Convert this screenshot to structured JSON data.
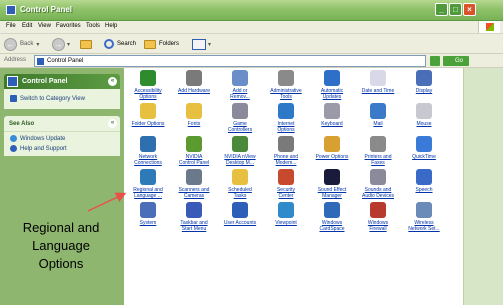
{
  "window": {
    "title": "Control Panel",
    "buttons": {
      "minimize": "_",
      "maximize": "□",
      "close": "×"
    }
  },
  "menu": [
    "File",
    "Edit",
    "View",
    "Favorites",
    "Tools",
    "Help"
  ],
  "toolbar": {
    "back_label": "Back",
    "search_label": "Search",
    "folders_label": "Folders"
  },
  "address": {
    "label": "Address",
    "value": "Control Panel",
    "go_label": "Go"
  },
  "task_pane": {
    "control_panel": {
      "title": "Control Panel",
      "collapse": "«",
      "link": "Switch to Category View"
    },
    "see_also": {
      "title": "See Also",
      "collapse": "«",
      "links": [
        "Windows Update",
        "Help and Support"
      ]
    }
  },
  "items": [
    {
      "label": "Accessibility\nOptions",
      "icon": "accessibility-icon",
      "color": "#2e8b2e"
    },
    {
      "label": "Add Hardware",
      "icon": "printer-hardware-icon",
      "color": "#7a7a7a"
    },
    {
      "label": "Add or\nRemov...",
      "icon": "add-remove-icon",
      "color": "#6a8fc8"
    },
    {
      "label": "Administrative\nTools",
      "icon": "admin-tools-icon",
      "color": "#8a8a8a"
    },
    {
      "label": "Automatic\nUpdates",
      "icon": "globe-update-icon",
      "color": "#2e6fc8"
    },
    {
      "label": "Date and Time",
      "icon": "clock-icon",
      "color": "#d8d8e8"
    },
    {
      "label": "Display",
      "icon": "display-icon",
      "color": "#4a6fb8"
    },
    {
      "label": "Folder Options",
      "icon": "folder-options-icon",
      "color": "#e8c040"
    },
    {
      "label": "Fonts",
      "icon": "fonts-folder-icon",
      "color": "#e8c040"
    },
    {
      "label": "Game\nControllers",
      "icon": "gamepad-icon",
      "color": "#8a8a9a"
    },
    {
      "label": "Internet\nOptions",
      "icon": "internet-icon",
      "color": "#2e78c8"
    },
    {
      "label": "Keyboard",
      "icon": "keyboard-icon",
      "color": "#9a9aa8"
    },
    {
      "label": "Mail",
      "icon": "mail-icon",
      "color": "#3a7ac8"
    },
    {
      "label": "Mouse",
      "icon": "mouse-icon",
      "color": "#c8c8d0"
    },
    {
      "label": "Network\nConnections",
      "icon": "network-icon",
      "color": "#2e6fb0"
    },
    {
      "label": "NVIDIA\nControl Panel",
      "icon": "nvidia-icon",
      "color": "#5a9a2e"
    },
    {
      "label": "NVIDIA nView\nDesktop M...",
      "icon": "nview-icon",
      "color": "#4a8a3a"
    },
    {
      "label": "Phone and\nModem...",
      "icon": "phone-icon",
      "color": "#7a7a7a"
    },
    {
      "label": "Power Options",
      "icon": "power-icon",
      "color": "#d8a030"
    },
    {
      "label": "Printers and\nFaxes",
      "icon": "printers-icon",
      "color": "#8a8a8a"
    },
    {
      "label": "QuickTime",
      "icon": "quicktime-icon",
      "color": "#3a7ad8"
    },
    {
      "label": "Regional and\nLanguage ...",
      "icon": "regional-globe-icon",
      "color": "#2e7ab8"
    },
    {
      "label": "Scanners and\nCameras",
      "icon": "scanner-icon",
      "color": "#6a7a8a"
    },
    {
      "label": "Scheduled\nTasks",
      "icon": "scheduled-tasks-icon",
      "color": "#e8c040"
    },
    {
      "label": "Security\nCenter",
      "icon": "shield-icon",
      "color": "#c84a2e"
    },
    {
      "label": "Sound Effect\nManager",
      "icon": "sound-effect-icon",
      "color": "#1a1a3a"
    },
    {
      "label": "Sounds and\nAudio Devices",
      "icon": "speaker-icon",
      "color": "#8a8a9a"
    },
    {
      "label": "Speech",
      "icon": "speech-icon",
      "color": "#3a6ac8"
    },
    {
      "label": "System",
      "icon": "system-icon",
      "color": "#4a6fb8"
    },
    {
      "label": "Taskbar and\nStart Menu",
      "icon": "taskbar-icon",
      "color": "#3a5ab8"
    },
    {
      "label": "User Accounts",
      "icon": "users-icon",
      "color": "#2e5fb8"
    },
    {
      "label": "Viewpoint",
      "icon": "viewpoint-icon",
      "color": "#2e8ac8"
    },
    {
      "label": "Windows\nCardSpace",
      "icon": "cardspace-icon",
      "color": "#2e6ab8"
    },
    {
      "label": "Windows\nFirewall",
      "icon": "firewall-icon",
      "color": "#b83a2e"
    },
    {
      "label": "Wireless\nNetwork Set...",
      "icon": "wireless-icon",
      "color": "#6a8ab8"
    }
  ],
  "annotation": {
    "text": "Regional and\nLanguage\nOptions",
    "arrow_color": "#e8504a"
  }
}
